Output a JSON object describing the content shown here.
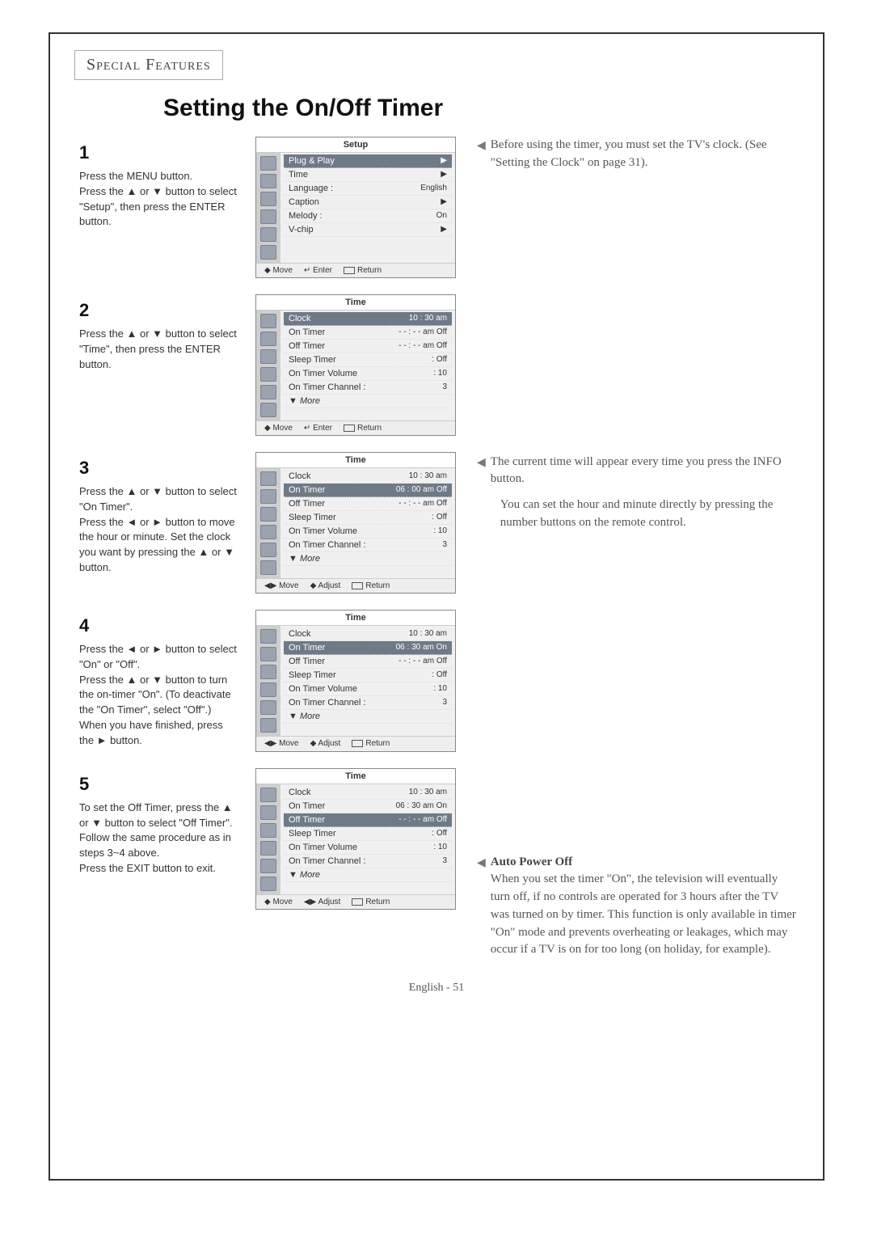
{
  "header": "Special Features",
  "title": "Setting the On/Off Timer",
  "footer": "English - 51",
  "steps": [
    {
      "num": "1",
      "text": "Press the MENU button.\n\nPress the ▲ or ▼ button to select \"Setup\", then press the ENTER button."
    },
    {
      "num": "2",
      "text": "Press the ▲ or ▼ button to select \"Time\", then press the ENTER button."
    },
    {
      "num": "3",
      "text": "Press the ▲ or ▼ button to select \"On Timer\".\n\nPress the ◄ or ► button to move the hour or minute. Set the clock you want by pressing the ▲ or ▼ button."
    },
    {
      "num": "4",
      "text": "Press the ◄ or ► button to select \"On\" or \"Off\".\n\nPress the ▲ or ▼ button to turn the on-timer \"On\". (To deactivate the \"On Timer\", select \"Off\".)\nWhen you have finished, press the ► button."
    },
    {
      "num": "5",
      "text": "To set the Off Timer, press the ▲ or ▼ button to select \"Off Timer\".\nFollow the same procedure as in steps 3~4 above.\n\nPress the EXIT button to exit."
    }
  ],
  "osd": [
    {
      "title": "Setup",
      "rows": [
        {
          "label": "Plug & Play",
          "value": "▶",
          "sel": true
        },
        {
          "label": "Time",
          "value": "▶"
        },
        {
          "label": "Language :",
          "value": "English"
        },
        {
          "label": "Caption",
          "value": "▶"
        },
        {
          "label": "Melody :",
          "value": "On"
        },
        {
          "label": "V-chip",
          "value": "▶"
        }
      ],
      "bar": [
        "◆ Move",
        "↵ Enter",
        "⏎ Return"
      ]
    },
    {
      "title": "Time",
      "rows": [
        {
          "label": "Clock",
          "value": "10 : 30 am",
          "sel": true
        },
        {
          "label": "On Timer",
          "value": "- - : - - am Off"
        },
        {
          "label": "Off Timer",
          "value": "- - : - - am Off"
        },
        {
          "label": "Sleep Timer",
          "value": ": Off"
        },
        {
          "label": "On Timer Volume",
          "value": ": 10"
        },
        {
          "label": "On Timer Channel :",
          "value": "3"
        },
        {
          "label": "▼ More",
          "value": ""
        }
      ],
      "bar": [
        "◆ Move",
        "↵ Enter",
        "⏎ Return"
      ]
    },
    {
      "title": "Time",
      "rows": [
        {
          "label": "Clock",
          "value": "10 : 30 am"
        },
        {
          "label": "On Timer",
          "value": "06 : 00 am Off",
          "sel": true
        },
        {
          "label": "Off Timer",
          "value": "- - : - - am Off"
        },
        {
          "label": "Sleep Timer",
          "value": ": Off"
        },
        {
          "label": "On Timer Volume",
          "value": ": 10"
        },
        {
          "label": "On Timer Channel :",
          "value": "3"
        },
        {
          "label": "▼ More",
          "value": ""
        }
      ],
      "bar": [
        "◀▶ Move",
        "◆ Adjust",
        "⏎ Return"
      ]
    },
    {
      "title": "Time",
      "rows": [
        {
          "label": "Clock",
          "value": "10 : 30 am"
        },
        {
          "label": "On Timer",
          "value": "06 : 30 am On",
          "sel": true
        },
        {
          "label": "Off Timer",
          "value": "- - : - - am Off"
        },
        {
          "label": "Sleep Timer",
          "value": ": Off"
        },
        {
          "label": "On Timer Volume",
          "value": ": 10"
        },
        {
          "label": "On Timer Channel :",
          "value": "3"
        },
        {
          "label": "▼ More",
          "value": ""
        }
      ],
      "bar": [
        "◀▶ Move",
        "◆ Adjust",
        "⏎ Return"
      ]
    },
    {
      "title": "Time",
      "rows": [
        {
          "label": "Clock",
          "value": "10 : 30 am"
        },
        {
          "label": "On Timer",
          "value": "06 : 30 am On"
        },
        {
          "label": "Off Timer",
          "value": "- - : - - am Off",
          "sel": true
        },
        {
          "label": "Sleep Timer",
          "value": ": Off"
        },
        {
          "label": "On Timer Volume",
          "value": ": 10"
        },
        {
          "label": "On Timer Channel :",
          "value": "3"
        },
        {
          "label": "▼ More",
          "value": ""
        }
      ],
      "bar": [
        "◆ Move",
        "◀▶ Adjust",
        "⏎ Return"
      ]
    }
  ],
  "notes": {
    "n1": "Before using the timer, you must set the TV's clock. (See \"Setting the Clock\" on page 31).",
    "n3a": "The current time will appear every time you press the INFO button.",
    "n3b": "You can set the hour and minute directly by pressing the number buttons on the remote control.",
    "n5_title": "Auto Power Off",
    "n5_body": "When you set the timer \"On\", the television will eventually turn off, if no controls are operated for 3 hours after the TV was turned on by timer. This function is only available in timer \"On\" mode and prevents overheating or leakages, which may occur if a TV is on for too long (on holiday, for example)."
  }
}
